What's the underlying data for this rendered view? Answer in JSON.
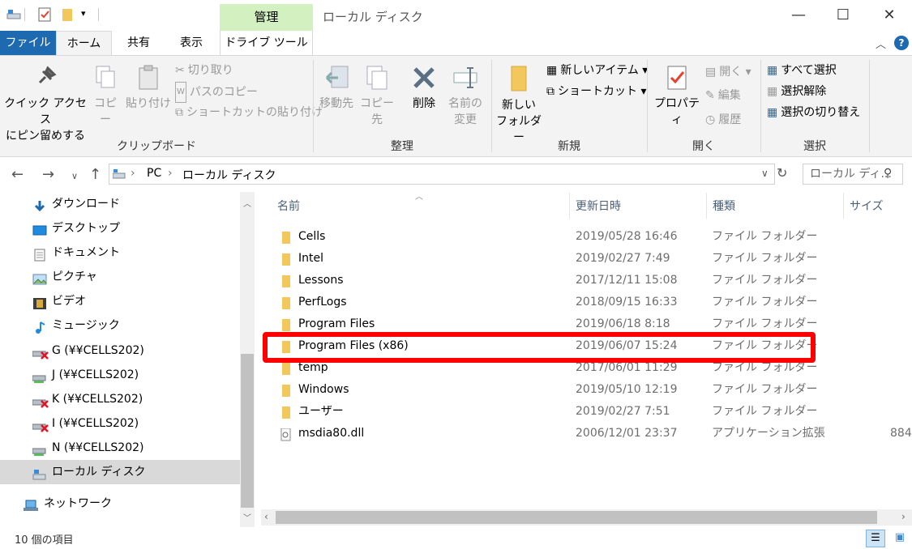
{
  "window": {
    "title": "ローカル ディスク",
    "context_tab": "管理",
    "minimize": "—",
    "maximize": "☐",
    "close": "✕"
  },
  "ribbon_tabs": {
    "file": "ファイル",
    "home": "ホーム",
    "share": "共有",
    "view": "表示",
    "drive_tools": "ドライブ ツール"
  },
  "ribbon": {
    "clipboard": {
      "label": "クリップボード",
      "pin_line1": "クイック アクセス",
      "pin_line2": "にピン留めする",
      "copy": "コピー",
      "paste": "貼り付け",
      "cut": "切り取り",
      "copy_path": "パスのコピー",
      "paste_shortcut": "ショートカットの貼り付け"
    },
    "organize": {
      "label": "整理",
      "move_to": "移動先",
      "copy_to": "コピー先",
      "delete": "削除",
      "rename_line1": "名前の",
      "rename_line2": "変更"
    },
    "new": {
      "label": "新規",
      "new_folder_line1": "新しい",
      "new_folder_line2": "フォルダー",
      "new_item": "新しいアイテム ▾",
      "easy_access": "ショートカット ▾"
    },
    "open": {
      "label": "開く",
      "properties": "プロパティ",
      "open": "開く ▾",
      "edit": "編集",
      "history": "履歴"
    },
    "select": {
      "label": "選択",
      "select_all": "すべて選択",
      "select_none": "選択解除",
      "invert": "選択の切り替え"
    }
  },
  "address": {
    "pc": "PC",
    "sep": "›",
    "location": "ローカル ディスク",
    "search_placeholder": "ローカル ディ..."
  },
  "nav": [
    {
      "label": "ダウンロード"
    },
    {
      "label": "デスクトップ"
    },
    {
      "label": "ドキュメント"
    },
    {
      "label": "ピクチャ"
    },
    {
      "label": "ビデオ"
    },
    {
      "label": "ミュージック"
    },
    {
      "label": "G (¥¥CELLS202)"
    },
    {
      "label": "J (¥¥CELLS202)"
    },
    {
      "label": "K (¥¥CELLS202)"
    },
    {
      "label": "I (¥¥CELLS202)"
    },
    {
      "label": "N (¥¥CELLS202)"
    },
    {
      "label": "ローカル ディスク"
    },
    {
      "label": "ネットワーク"
    }
  ],
  "columns": {
    "name": "名前",
    "date": "更新日時",
    "type": "種類",
    "size": "サイズ"
  },
  "files": [
    {
      "name": "Cells",
      "date": "2019/05/28 16:46",
      "type": "ファイル フォルダー",
      "size": ""
    },
    {
      "name": "Intel",
      "date": "2019/02/27 7:49",
      "type": "ファイル フォルダー",
      "size": ""
    },
    {
      "name": "Lessons",
      "date": "2017/12/11 15:08",
      "type": "ファイル フォルダー",
      "size": ""
    },
    {
      "name": "PerfLogs",
      "date": "2018/09/15 16:33",
      "type": "ファイル フォルダー",
      "size": ""
    },
    {
      "name": "Program Files",
      "date": "2019/06/18 8:18",
      "type": "ファイル フォルダー",
      "size": ""
    },
    {
      "name": "Program Files (x86)",
      "date": "2019/06/07 15:24",
      "type": "ファイル フォルダー",
      "size": ""
    },
    {
      "name": "temp",
      "date": "2017/06/01 11:29",
      "type": "ファイル フォルダー",
      "size": ""
    },
    {
      "name": "Windows",
      "date": "2019/05/10 12:19",
      "type": "ファイル フォルダー",
      "size": ""
    },
    {
      "name": "ユーザー",
      "date": "2019/02/27 7:51",
      "type": "ファイル フォルダー",
      "size": ""
    },
    {
      "name": "msdia80.dll",
      "date": "2006/12/01 23:37",
      "type": "アプリケーション拡張",
      "size": "884"
    }
  ],
  "status": {
    "count": "10 個の項目"
  },
  "colors": {
    "file_tab": "#1e6ab0",
    "manage_tab": "#d3f0c0",
    "highlight": "#ff0000",
    "folder": "#f2c75c"
  }
}
